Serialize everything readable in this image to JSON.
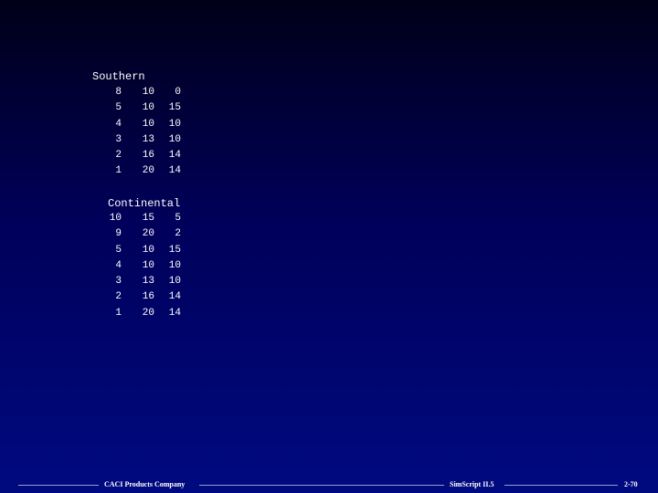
{
  "sections": [
    {
      "title": "Southern",
      "rows": [
        [
          "8",
          "10",
          "0"
        ],
        [
          "5",
          "10",
          "15"
        ],
        [
          "4",
          "10",
          "10"
        ],
        [
          "3",
          "13",
          "10"
        ],
        [
          "2",
          "16",
          "14"
        ],
        [
          "1",
          "20",
          "14"
        ]
      ]
    },
    {
      "title": "Continental",
      "rows": [
        [
          "10",
          "15",
          "5"
        ],
        [
          "9",
          "20",
          "2"
        ],
        [
          "5",
          "10",
          "15"
        ],
        [
          "4",
          "10",
          "10"
        ],
        [
          "3",
          "13",
          "10"
        ],
        [
          "2",
          "16",
          "14"
        ],
        [
          "1",
          "20",
          "14"
        ]
      ]
    }
  ],
  "footer": {
    "company": "CACI Products Company",
    "product": "SimScript II.5",
    "page": "2-70"
  }
}
